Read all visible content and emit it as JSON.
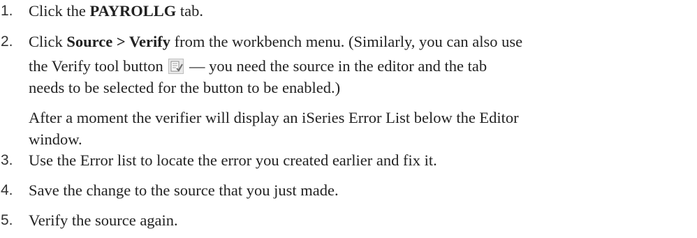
{
  "steps": [
    {
      "number": "1.",
      "pre": "Click the ",
      "bold": "PAYROLLG",
      "post": " tab."
    },
    {
      "number": "2.",
      "pre": "Click ",
      "bold": "Source > Verify",
      "post": " from the workbench menu. (Similarly, you can also use",
      "line2_pre": "the Verify tool button",
      "line2_post": "— you need the source in the editor and the tab",
      "line3": "needs to be selected for the button to be enabled.)",
      "note_line1": "After a moment the verifier will display an iSeries Error List below the Editor",
      "note_line2": "window.",
      "icon": "verify-tool-icon"
    },
    {
      "number": "3.",
      "text": "Use the Error list to locate the error you created earlier and fix it."
    },
    {
      "number": "4.",
      "text": "Save the change to the source that you just made."
    },
    {
      "number": "5.",
      "text": "Verify the source again."
    }
  ]
}
